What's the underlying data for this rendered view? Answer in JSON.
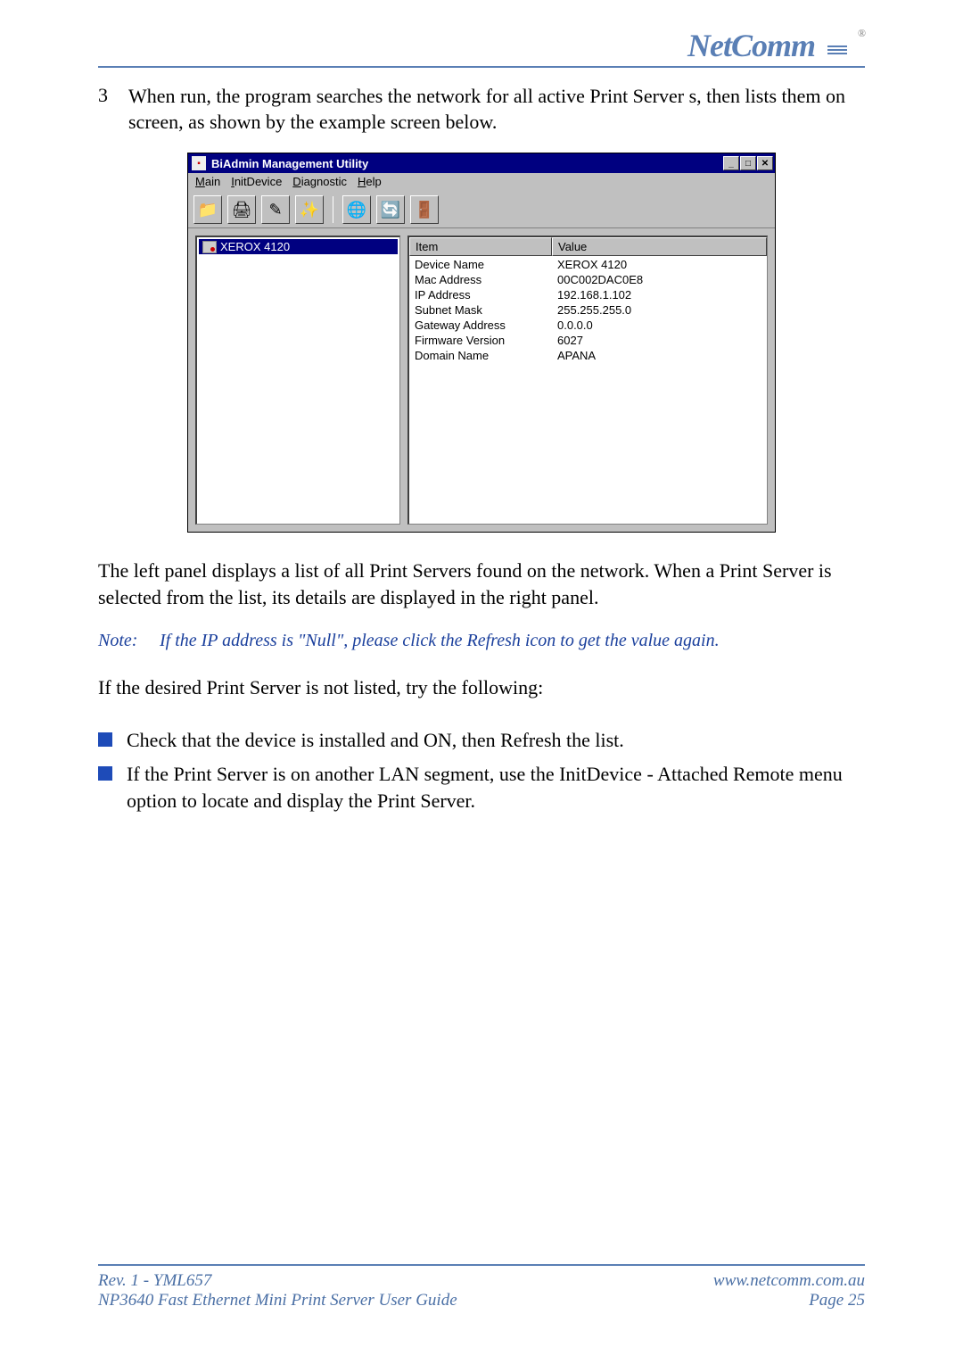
{
  "header": {
    "logo_text": "NetComm",
    "reg": "®"
  },
  "intro": {
    "number": "3",
    "text": "When run, the program searches the network for all active Print Server s, then lists them on screen, as shown by the example screen below."
  },
  "app": {
    "title": "BiAdmin Management Utility",
    "menu": [
      "Main",
      "InitDevice",
      "Diagnostic",
      "Help"
    ],
    "toolbar": [
      "📁",
      "🖨",
      "✎",
      "✨",
      "🌐",
      "🔄",
      "🚪"
    ],
    "left_item": "XEROX 4120",
    "columns": {
      "item": "Item",
      "value": "Value"
    },
    "rows": [
      {
        "item": "Device Name",
        "value": "XEROX 4120"
      },
      {
        "item": "Mac Address",
        "value": "00C002DAC0E8"
      },
      {
        "item": "IP Address",
        "value": "192.168.1.102"
      },
      {
        "item": "Subnet Mask",
        "value": "255.255.255.0"
      },
      {
        "item": "Gateway Address",
        "value": "0.0.0.0"
      },
      {
        "item": "Firmware Version",
        "value": "6027"
      },
      {
        "item": "Domain Name",
        "value": "APANA"
      }
    ]
  },
  "para1": "The left panel displays a list of all Print Servers found on the network. When a Print Server is selected from the list, its details are displayed in the right panel.",
  "note": {
    "label": "Note:",
    "text": "If the IP address is \"Null\", please click the Refresh icon to get the value again."
  },
  "para2": "If the desired Print Server is not listed, try the following:",
  "bullets": [
    "Check that the device is installed and ON, then Refresh the list.",
    "If the Print Server is on another LAN segment, use the InitDevice - Attached Remote menu option to locate and display the Print Server."
  ],
  "footer": {
    "left1": "Rev. 1 - YML657",
    "left2": "NP3640 Fast Ethernet Mini Print Server User Guide",
    "right1": "www.netcomm.com.au",
    "right2": "Page 25"
  }
}
